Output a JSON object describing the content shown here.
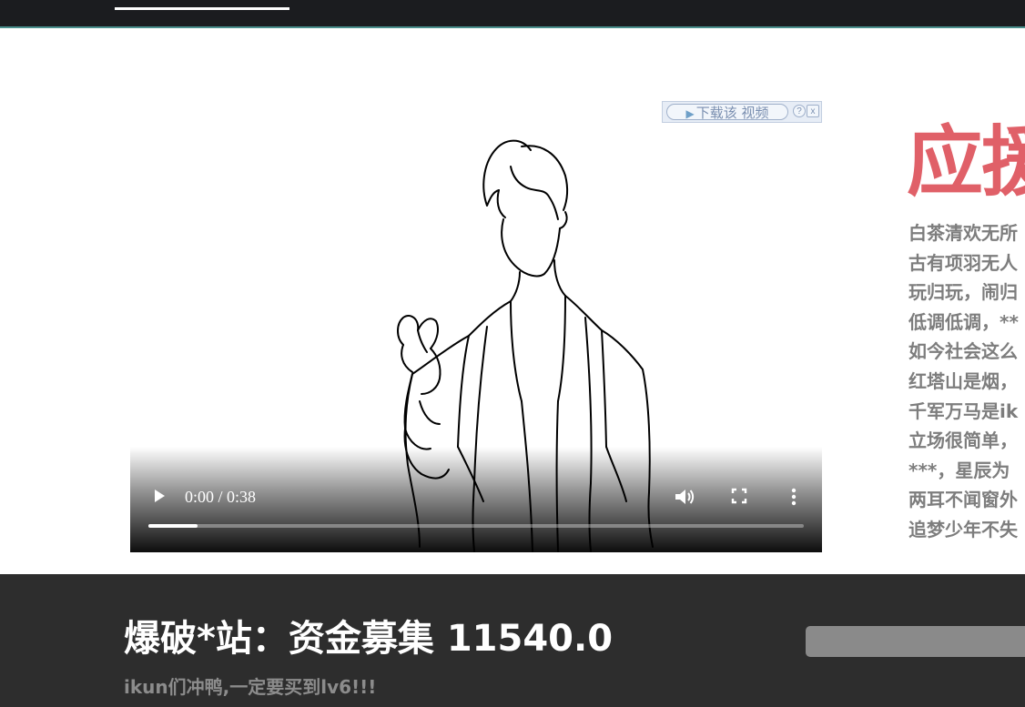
{
  "video": {
    "download_button_label": "下载该 视频",
    "help_label": "?",
    "close_label": "x",
    "time_display": "0:00 / 0:38",
    "buffered_fraction": 0.075,
    "icons": [
      "play-icon",
      "volume-icon",
      "fullscreen-icon",
      "more-options-icon"
    ]
  },
  "side": {
    "title": "应援",
    "lyrics": [
      "白茶清欢无所",
      "古有项羽无人",
      "玩归玩，闹归",
      "低调低调，**",
      "如今社会这么",
      "红塔山是烟，",
      "千军万马是ik",
      "立场很简单，",
      "***，星辰为",
      "两耳不闻窗外",
      "追梦少年不失"
    ]
  },
  "footer": {
    "fund_title": "爆破*站：资金募集 11540.0",
    "fund_subtitle": "ikun们冲鸭,一定要买到lv6!!!"
  },
  "colors": {
    "topbar": "#1b1c1f",
    "topbar_accent": "#4a8f8c",
    "side_title": "#e06068",
    "lyrics_text": "#7d7d7d",
    "footer_bg": "#2d2d2d"
  }
}
